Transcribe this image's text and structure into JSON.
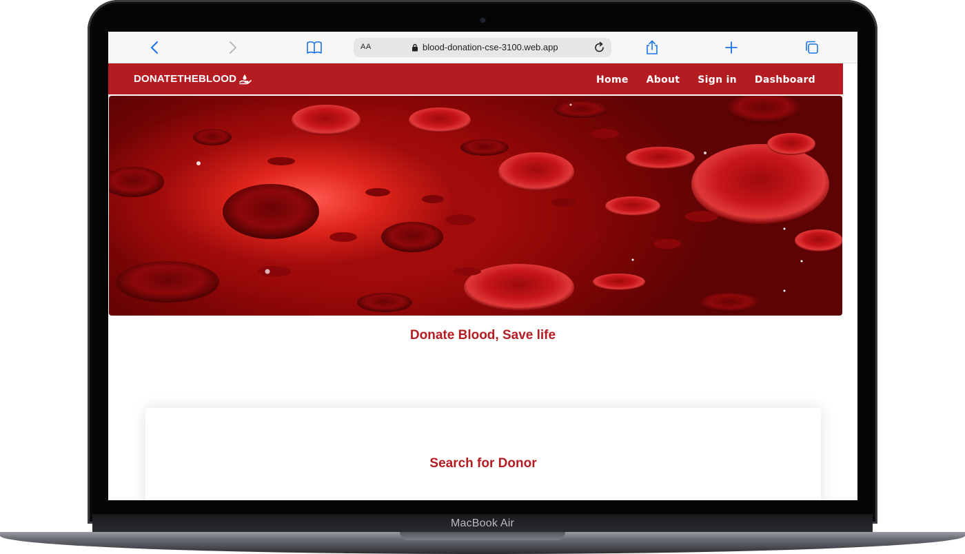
{
  "device": {
    "label": "MacBook Air"
  },
  "browser": {
    "text_size_label": "AA",
    "url": "blood-donation-cse-3100.web.app",
    "icons": [
      "back-icon",
      "forward-icon",
      "bookmarks-icon",
      "lock-icon",
      "reload-icon",
      "share-icon",
      "new-tab-icon",
      "tabs-icon"
    ]
  },
  "navbar": {
    "brand": "DONATETHEBLOOD",
    "brand_icon": "hand-droplet-icon",
    "links": [
      "Home",
      "About",
      "Sign in",
      "Dashboard"
    ],
    "color": "#b51c22"
  },
  "hero": {
    "image": "red-blood-cells-illustration"
  },
  "tagline": "Donate Blood, Save life",
  "search_card": {
    "title": "Search for Donor"
  }
}
